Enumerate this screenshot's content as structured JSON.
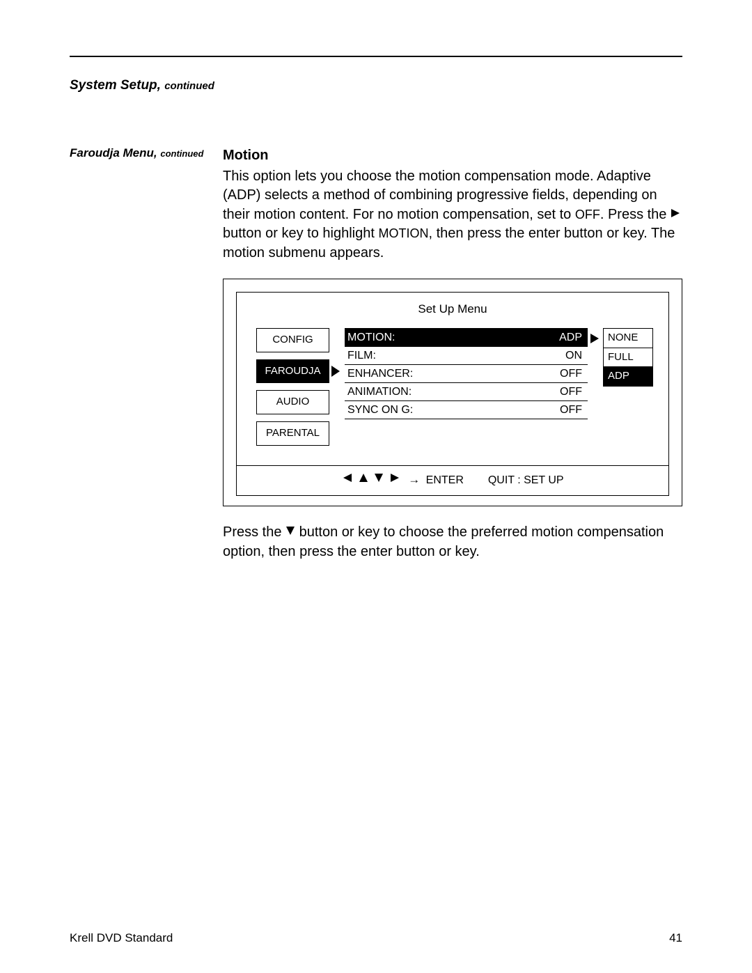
{
  "header": {
    "section": "System Setup,",
    "cont": "continued"
  },
  "side": {
    "title": "Faroudja Menu,",
    "cont": "continued"
  },
  "main": {
    "title": "Motion",
    "para1a": "This option lets you choose the motion compensation mode. Adaptive (ADP) selects a method of combining progressive fields, depending on their motion content. For no motion compensation, set to ",
    "off": "OFF",
    "para1b": ". Press the ",
    "para1c": " button or key to highlight ",
    "motion": "MOTION",
    "para1d": ", then press the enter button or key. The motion submenu appears.",
    "para2a": "Press the ",
    "para2b": " button or key to choose the preferred motion compensation option, then press the enter button or key."
  },
  "osd": {
    "title": "Set Up Menu",
    "tabs": [
      "CONFIG",
      "FAROUDJA",
      "AUDIO",
      "PARENTAL"
    ],
    "params": [
      {
        "label": "MOTION:",
        "value": "ADP",
        "hl": true,
        "arrow": true
      },
      {
        "label": "FILM:",
        "value": "ON"
      },
      {
        "label": "ENHANCER:",
        "value": "OFF"
      },
      {
        "label": "ANIMATION:",
        "value": "OFF"
      },
      {
        "label": "SYNC ON G:",
        "value": "OFF"
      }
    ],
    "opts": [
      {
        "label": "NONE"
      },
      {
        "label": "FULL"
      },
      {
        "label": "ADP",
        "hl": true
      }
    ],
    "footer": {
      "enter": "ENTER",
      "quit": "QUIT : SET UP",
      "arrow": "→"
    }
  },
  "footer": {
    "left": "Krell DVD Standard",
    "right": "41"
  }
}
